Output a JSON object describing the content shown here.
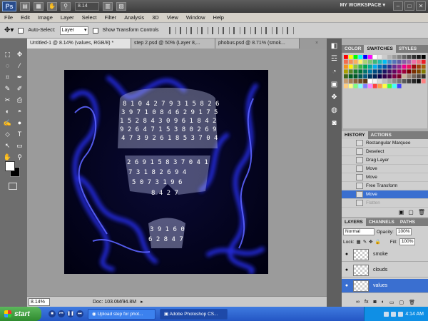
{
  "appbar": {
    "logo": "Ps",
    "zoom": "8.14",
    "workspace": "MY WORKSPACE ▾",
    "window_buttons": [
      "–",
      "□",
      "✕"
    ]
  },
  "menu": [
    "File",
    "Edit",
    "Image",
    "Layer",
    "Select",
    "Filter",
    "Analysis",
    "3D",
    "View",
    "Window",
    "Help"
  ],
  "options": {
    "auto_select_label": "Auto-Select:",
    "auto_select_value": "Layer",
    "show_transform_label": "Show Transform Controls"
  },
  "tabs": [
    {
      "label": "Untitled-1 @ 8.14% (values, RGB/8) *"
    },
    {
      "label": "step 2.psd @ 50% (Layer 8,..."
    },
    {
      "label": "phobus.psd @ 8.71% (smok..."
    }
  ],
  "tab_close": "×",
  "tools": [
    "⬚",
    "✥",
    "◌",
    "⁄",
    "⌗",
    "✒",
    "✎",
    "✐",
    "✂",
    "⎙",
    "◐",
    "◓",
    "✍",
    "●",
    "⬦",
    "T",
    "↖",
    "▭",
    "✋",
    "⚲"
  ],
  "statusbar": {
    "zoom": "8.14%",
    "doc": "Doc: 103.0M/94.8M"
  },
  "iconstrip": [
    "◧",
    "☲",
    "◔",
    "▣",
    "❖",
    "◍",
    "◙"
  ],
  "swatches": {
    "tabs": [
      "COLOR",
      "SWATCHES",
      "STYLES"
    ],
    "active": 1,
    "colors": [
      "#ff0000",
      "#ffff00",
      "#00ff00",
      "#00ffff",
      "#0000ff",
      "#ff00ff",
      "#ffffff",
      "#e6e6e6",
      "#cccccc",
      "#b3b3b3",
      "#999999",
      "#808080",
      "#666666",
      "#4d4d4d",
      "#333333",
      "#1a1a1a",
      "#000000",
      "#f26c4f",
      "#f68e55",
      "#fbaf5c",
      "#fff467",
      "#acd372",
      "#7cc576",
      "#3bb878",
      "#1abbb4",
      "#00bff3",
      "#438ccb",
      "#5574b9",
      "#605ca8",
      "#855fa8",
      "#a763a8",
      "#f06ea9",
      "#f26d7d",
      "#ed1c24",
      "#f7941d",
      "#fff200",
      "#8dc63f",
      "#39b54a",
      "#00a651",
      "#00a99d",
      "#00aeef",
      "#0072bc",
      "#0054a6",
      "#2e3192",
      "#662d91",
      "#92278f",
      "#ec008c",
      "#ed145b",
      "#9e0b0f",
      "#a0410d",
      "#a36209",
      "#aba000",
      "#598527",
      "#197b30",
      "#007236",
      "#00746b",
      "#0076a3",
      "#004a80",
      "#003471",
      "#1b1464",
      "#440e62",
      "#630460",
      "#9e005d",
      "#9e0039",
      "#790000",
      "#7b2e00",
      "#7d4900",
      "#827b00",
      "#406618",
      "#005e20",
      "#005826",
      "#005952",
      "#005b7f",
      "#003663",
      "#002157",
      "#0d004c",
      "#32004b",
      "#4b0049",
      "#7b0046",
      "#7a0026",
      "#c7b299",
      "#998675",
      "#736357",
      "#534741",
      "#37302a",
      "#c69c6d",
      "#a67c52",
      "#8c6239",
      "#754c24",
      "#603913",
      "#ffffff",
      "#f2f2f2",
      "#d9d9d9",
      "#bfbfbf",
      "#a6a6a6",
      "#8c8c8c",
      "#737373",
      "#595959",
      "#404040",
      "#262626",
      "#0d0d0d",
      "#ff8080",
      "#ffcc80",
      "#ffff80",
      "#80ff80",
      "#80ffff",
      "#8080ff",
      "#ff80ff",
      "#ff4040",
      "#ffa040",
      "#ffff40",
      "#40ff40",
      "#40ffff",
      "#4040ff"
    ]
  },
  "history": {
    "tabs": [
      "HISTORY",
      "ACTIONS"
    ],
    "items": [
      {
        "label": "Rectangular Marquee"
      },
      {
        "label": "Deselect"
      },
      {
        "label": "Drag Layer"
      },
      {
        "label": "Move"
      },
      {
        "label": "Move"
      },
      {
        "label": "Free Transform"
      },
      {
        "label": "Move",
        "selected": true
      },
      {
        "label": "Flatten",
        "dim": true
      }
    ]
  },
  "layers": {
    "tabs": [
      "LAYERS",
      "CHANNELS",
      "PATHS"
    ],
    "blend": "Normal",
    "opacity_label": "Opacity:",
    "opacity": "100%",
    "lock_label": "Lock:",
    "fill_label": "Fill:",
    "fill": "100%",
    "items": [
      {
        "name": "smoke"
      },
      {
        "name": "clouds"
      },
      {
        "name": "values",
        "selected": true
      }
    ]
  },
  "taskbar": {
    "start": "start",
    "buttons": [
      "Upload step for phot...",
      "Adobe Photoshop CS..."
    ],
    "time": "4:14 AM"
  }
}
